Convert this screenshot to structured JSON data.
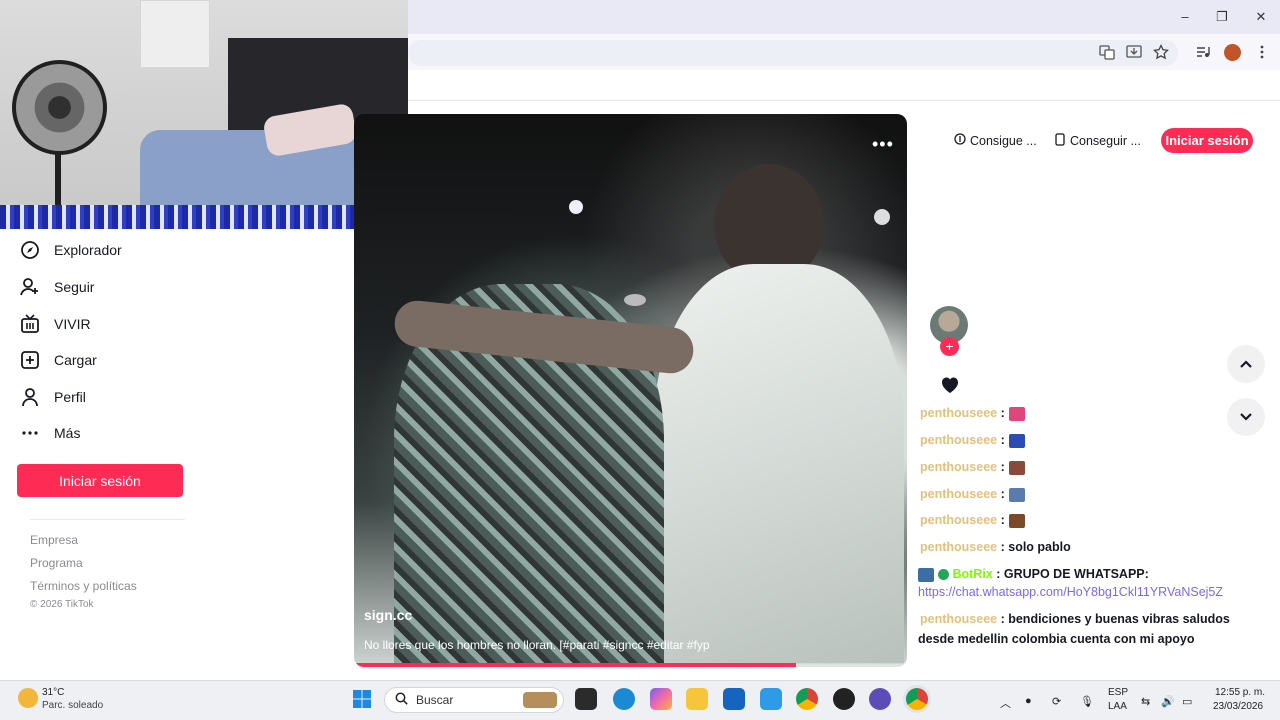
{
  "browser": {
    "controls": {
      "minimize": "–",
      "restore": "❐",
      "close": "✕"
    },
    "toolbar_icons": [
      "translate-icon",
      "install-app-icon",
      "bookmark-star-icon",
      "media-control-icon",
      "profile-avatar",
      "menu-icon"
    ]
  },
  "sidebar": {
    "items": [
      {
        "label": "Explorador",
        "icon": "compass-icon"
      },
      {
        "label": "Seguir",
        "icon": "follow-user-icon"
      },
      {
        "label": "VIVIR",
        "icon": "live-tv-icon"
      },
      {
        "label": "Cargar",
        "icon": "upload-plus-icon"
      },
      {
        "label": "Perfil",
        "icon": "profile-icon"
      },
      {
        "label": "Más",
        "icon": "more-dots-icon"
      }
    ],
    "login_label": "Iniciar sesión",
    "footer": {
      "company": "Empresa",
      "program": "Programa",
      "terms": "Términos y políticas",
      "copyright": "© 2026 TikTok"
    }
  },
  "header": {
    "get_coins_label": "Consigue ...",
    "get_app_label": "Conseguir ...",
    "login_label": "Iniciar sesión"
  },
  "video": {
    "more_label": "•••",
    "author": "sign.cc",
    "caption": "No llores que los hombres no lloran. [#parati #signcc #editar #fyp",
    "progress": 0.8
  },
  "chat": {
    "messages": [
      {
        "user": "penthouseee",
        "sep": ":",
        "text": "",
        "emote_color": "#e0457b"
      },
      {
        "user": "penthouseee",
        "sep": ":",
        "text": "",
        "emote_color": "#2b4bb5"
      },
      {
        "user": "penthouseee",
        "sep": ":",
        "text": "",
        "emote_color": "#8a4a3a"
      },
      {
        "user": "penthouseee",
        "sep": ":",
        "text": "",
        "emote_color": "#5a7bb0"
      },
      {
        "user": "penthouseee",
        "sep": ":",
        "text": "",
        "emote_color": "#7a4a2a"
      },
      {
        "user": "penthouseee",
        "sep": ":",
        "text": "solo pablo",
        "emote_color": ""
      }
    ],
    "bot": {
      "name": "BotRix",
      "text": "GRUPO DE WHATSAPP:",
      "link": "https://chat.whatsapp.com/HoY8bg1Ckl11YRVaNSej5Z"
    },
    "last": {
      "user": "penthouseee",
      "line1": "bendiciones y buenas vibras saludos",
      "line2": "desde medellin colombia cuenta con mi apoyo"
    }
  },
  "taskbar": {
    "weather_temp": "31°C",
    "weather_desc": "Parc. soleado",
    "search_placeholder": "Buscar",
    "lang_top": "ESP",
    "lang_bottom": "LAA",
    "time": "12:55 p. m.",
    "date": "23/03/2026"
  },
  "colors": {
    "brand": "#fe2c55",
    "chat_user": "#e5c07b",
    "link": "#7b68ee"
  }
}
